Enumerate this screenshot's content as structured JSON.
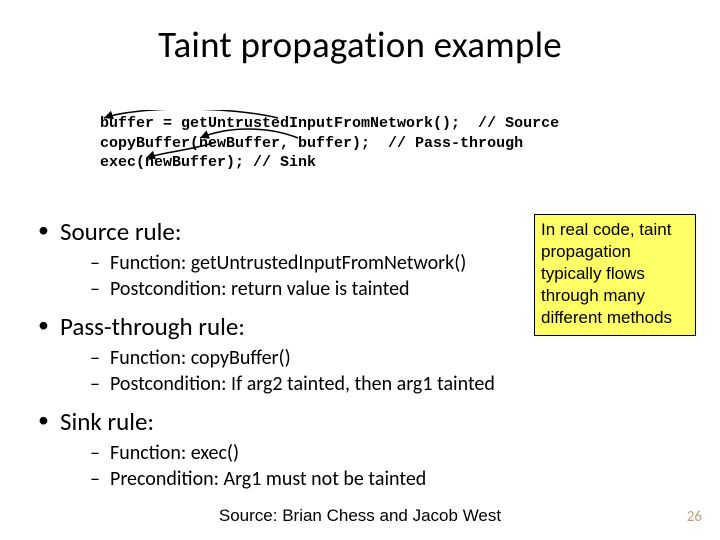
{
  "title": "Taint propagation example",
  "code": {
    "line1": "buffer = getUntrustedInputFromNetwork();  // Source",
    "line2": "copyBuffer(newBuffer, buffer);  // Pass-through",
    "line3": "exec(newBuffer); // Sink"
  },
  "rules": {
    "source": {
      "heading": "Source rule:",
      "fn": "Function: getUntrustedInputFromNetwork()",
      "post": "Postcondition: return value is tainted"
    },
    "passthrough": {
      "heading": "Pass-through rule:",
      "fn": "Function: copyBuffer()",
      "post": "Postcondition: If arg2 tainted, then arg1 tainted"
    },
    "sink": {
      "heading": "Sink rule:",
      "fn": "Function: exec()",
      "pre": "Precondition: Arg1 must not be tainted"
    }
  },
  "callout": "In real code, taint propagation typically flows through many different methods",
  "credit": "Source: Brian Chess and Jacob West",
  "page": "26"
}
